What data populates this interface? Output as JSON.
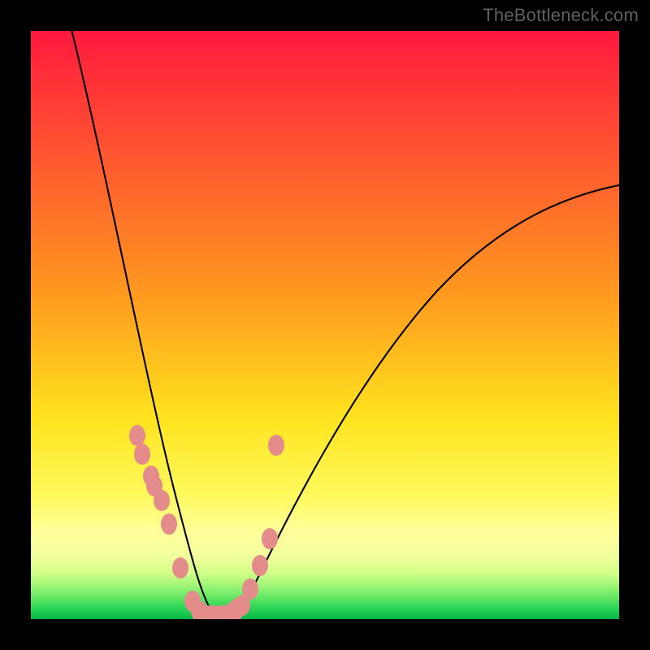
{
  "watermark": {
    "text": "TheBottleneck.com"
  },
  "chart_data": {
    "type": "line",
    "title": "",
    "xlabel": "",
    "ylabel": "",
    "xlim": [
      0,
      100
    ],
    "ylim": [
      0,
      100
    ],
    "series": [
      {
        "name": "bottleneck-curve",
        "x": [
          2,
          4,
          6,
          8,
          10,
          12,
          14,
          16,
          18,
          20,
          22,
          24,
          26,
          28,
          30,
          32,
          35,
          40,
          45,
          50,
          55,
          60,
          65,
          70,
          75,
          80,
          85,
          90,
          95,
          100
        ],
        "y": [
          100,
          90,
          80,
          71,
          62,
          54,
          46,
          39,
          32,
          26,
          20,
          14,
          9,
          5,
          2,
          0,
          0,
          3,
          9,
          17,
          26,
          35,
          43,
          50,
          56,
          61,
          65,
          69,
          72,
          74
        ]
      }
    ],
    "markers": {
      "name": "highlighted-points",
      "color": "#e48b8b",
      "x": [
        18.2,
        19.0,
        20.5,
        21.0,
        22.3,
        23.5,
        25.5,
        27.5,
        28.7,
        30.0,
        31.3,
        32.5,
        33.0,
        34.3,
        35.0,
        36.0,
        37.3,
        39.0,
        40.6,
        41.8
      ],
      "y": [
        31.0,
        28.0,
        24.2,
        22.5,
        20.0,
        16.0,
        8.5,
        2.8,
        1.2,
        0.4,
        0.4,
        0.4,
        0.4,
        1.0,
        1.5,
        2.3,
        5.0,
        9.0,
        13.5,
        29.5
      ]
    },
    "gradient_bands": [
      {
        "at": 0,
        "color": "#ff193e"
      },
      {
        "at": 45,
        "color": "#ff9a1f"
      },
      {
        "at": 66,
        "color": "#ffe41e"
      },
      {
        "at": 79,
        "color": "#fffa5e"
      },
      {
        "at": 85,
        "color": "#ffff99"
      },
      {
        "at": 89,
        "color": "#f3ff9e"
      },
      {
        "at": 92,
        "color": "#d4ff8a"
      },
      {
        "at": 94,
        "color": "#a8f77a"
      },
      {
        "at": 96,
        "color": "#6ee867"
      },
      {
        "at": 98,
        "color": "#2fd658"
      },
      {
        "at": 100,
        "color": "#04b847"
      }
    ]
  }
}
